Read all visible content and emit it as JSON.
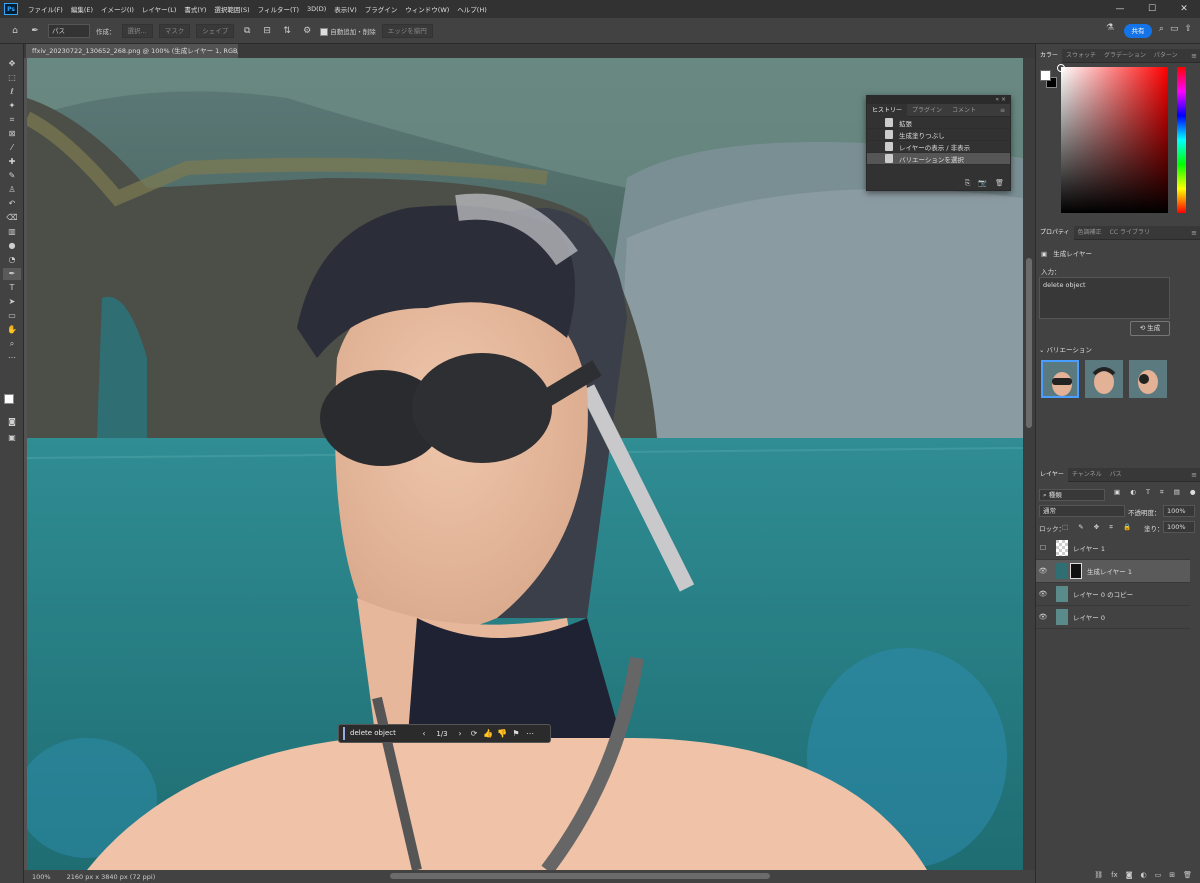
{
  "app": {
    "logo": "Ps"
  },
  "menu": [
    "ファイル(F)",
    "編集(E)",
    "イメージ(I)",
    "レイヤー(L)",
    "書式(Y)",
    "選択範囲(S)",
    "フィルター(T)",
    "3D(D)",
    "表示(V)",
    "プラグイン",
    "ウィンドウ(W)",
    "ヘルプ(H)"
  ],
  "window_controls": [
    "—",
    "☐",
    "✕"
  ],
  "options": {
    "mode": "パス",
    "create_label": "作成：",
    "btn_select": "選択...",
    "btn_mask": "マスク",
    "btn_shape": "シェイプ",
    "auto_add_delete": "自動追加・削除",
    "align_edges": "エッジを揃円",
    "share": "共有"
  },
  "document": {
    "tab_title": "ffxiv_20230722_130652_268.png @ 100% (生成レイヤー 1, RGB/8#) *",
    "tab_close": "×",
    "zoom": "100%",
    "size": "2160 px x 3840 px (72 ppi)"
  },
  "contextual_bar": {
    "prompt": "delete object",
    "counter": "1/3"
  },
  "history_panel": {
    "collapse": "« ×",
    "tabs": [
      "ヒストリー",
      "プラグイン",
      "コメント"
    ],
    "items": [
      "拡張",
      "生成塗りつぶし",
      "レイヤーの表示 / 非表示",
      "バリエーションを選択"
    ],
    "selected_index": 3
  },
  "color_panel": {
    "tabs": [
      "カラー",
      "スウォッチ",
      "グラデーション",
      "パターン"
    ],
    "foreground": "#ffffff",
    "background": "#000000",
    "hue_color": "#ff0000"
  },
  "properties_panel": {
    "tabs": [
      "プロパティ",
      "色調補正",
      "CC ライブラリ"
    ],
    "layer_type": "生成レイヤー",
    "prompt_label": "入力：",
    "prompt_value": "delete object",
    "generate_button": "生成",
    "variations_label": "バリエーション"
  },
  "layers_panel": {
    "tabs": [
      "レイヤー",
      "チャンネル",
      "パス"
    ],
    "filter": "種類",
    "blend_mode": "通常",
    "opacity_label": "不透明度：",
    "opacity": "100%",
    "lock_label": "ロック：",
    "fill_label": "塗り：",
    "fill": "100%",
    "layers": [
      {
        "name": "レイヤー 1",
        "visible": false,
        "selected": false
      },
      {
        "name": "生成レイヤー 1",
        "visible": true,
        "selected": true
      },
      {
        "name": "レイヤー 0 のコピー",
        "visible": true,
        "selected": false
      },
      {
        "name": "レイヤー 0",
        "visible": true,
        "selected": false
      }
    ]
  },
  "icons": {
    "home": "home-icon",
    "pen": "pen-icon",
    "search": "search-icon",
    "workspace": "workspace-icon",
    "share": "share-icon",
    "flask": "flask-icon"
  }
}
